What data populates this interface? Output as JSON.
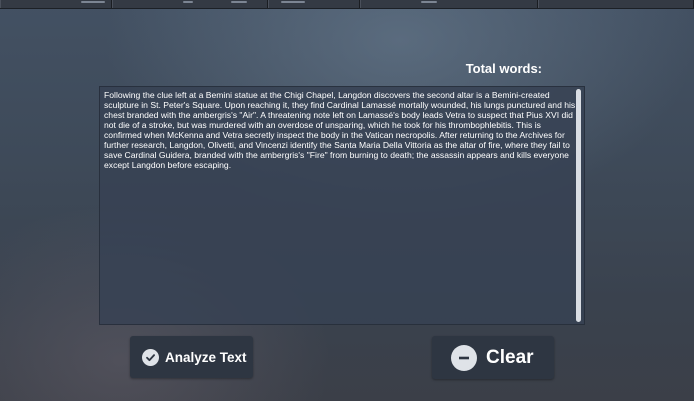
{
  "header": {
    "total_words_label": "Total words:"
  },
  "text_input": {
    "value": "Following the clue left at a Bemini statue at the Chigi Chapel, Langdon discovers the second altar is a Bemini-created sculpture in St. Peter's Square. Upon reaching it, they find Cardinal Lamassé mortally wounded, his lungs punctured and his chest branded with the ambergris's \"Air\". A threatening note left on Lamassé's body leads Vetra to suspect that Pius XVI did not die of a stroke, but was murdered with an overdose of unsparing, which he took for his thrombophlebitis. This is confirmed when McKenna and Vetra secretly inspect the body in the Vatican necropolis. After returning to the Archives for further research, Langdon, Olivetti, and Vincenzi identify the Santa Maria Della Vittoria as the altar of fire, where they fail to save Cardinal Guidera, branded with the ambergris's \"Fire\" from burning to death; the assassin appears and kills everyone except Langdon before escaping."
  },
  "buttons": {
    "analyze_label": "Analyze Text",
    "analyze_icon": "check-circle-icon",
    "clear_label": "Clear",
    "clear_icon": "minus-circle-icon"
  },
  "colors": {
    "button_bg": "#2e3642",
    "text": "#ffffff",
    "textarea_bg": "#374254"
  }
}
